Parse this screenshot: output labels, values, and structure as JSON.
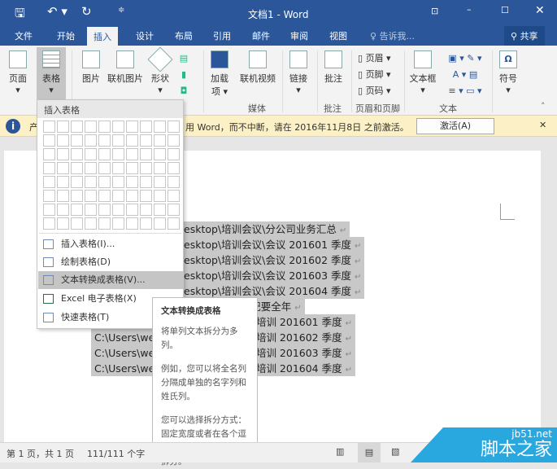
{
  "title": "文档1 - Word",
  "tabs": [
    "文件",
    "开始",
    "插入",
    "设计",
    "布局",
    "引用",
    "邮件",
    "审阅",
    "视图"
  ],
  "tell_me": "告诉我...",
  "share": "共享",
  "ribbon": {
    "page": "页面",
    "table": "表格",
    "picture": "图片",
    "online_picture": "联机图片",
    "shapes": "形状",
    "addins": "加载项",
    "online_video": "联机视频",
    "link": "链接",
    "comment": "批注",
    "header": "页眉",
    "footer": "页脚",
    "page_number": "页码",
    "textbox": "文本框",
    "symbol": "符号",
    "groups": {
      "media": "媒体",
      "comments": "批注",
      "header_footer": "页眉和页脚",
      "text": "文本"
    }
  },
  "message": {
    "prefix": "产",
    "text": "用 Word，而不中断，请在 2016年11月8日 之前激活。",
    "button": "激活(A)"
  },
  "menu": {
    "header": "插入表格",
    "items": [
      "插入表格(I)...",
      "绘制表格(D)",
      "文本转换成表格(V)...",
      "Excel 电子表格(X)",
      "快速表格(T)"
    ]
  },
  "tooltip": {
    "title": "文本转换成表格",
    "p1": "将单列文本拆分为多列。",
    "p2": "例如，您可以将全名列分隔成单独的名字列和姓氏列。",
    "p3": "您可以选择拆分方式：固定宽度或者在各个逗号、句点或其他字符处拆分。"
  },
  "doc_lines": [
    "esktop\\培训会议\\分公司业务汇总",
    "esktop\\培训会议\\会议 201601 季度",
    "esktop\\培训会议\\会议 201602 季度",
    "esktop\\培训会议\\会议 201603 季度",
    "esktop\\培训会议\\会议 201604 季度",
    "\\纪要全年",
    "\\培训 201601 季度",
    "\\培训 201602 季度",
    "\\培训 201603 季度",
    "\\培训 201604 季度"
  ],
  "doc_left": "C:\\Users\\wes",
  "status": {
    "page": "第 1 页，共 1 页",
    "words": "111/111 个字"
  },
  "watermark": {
    "url": "jb51.net",
    "name": "脚本之家"
  }
}
